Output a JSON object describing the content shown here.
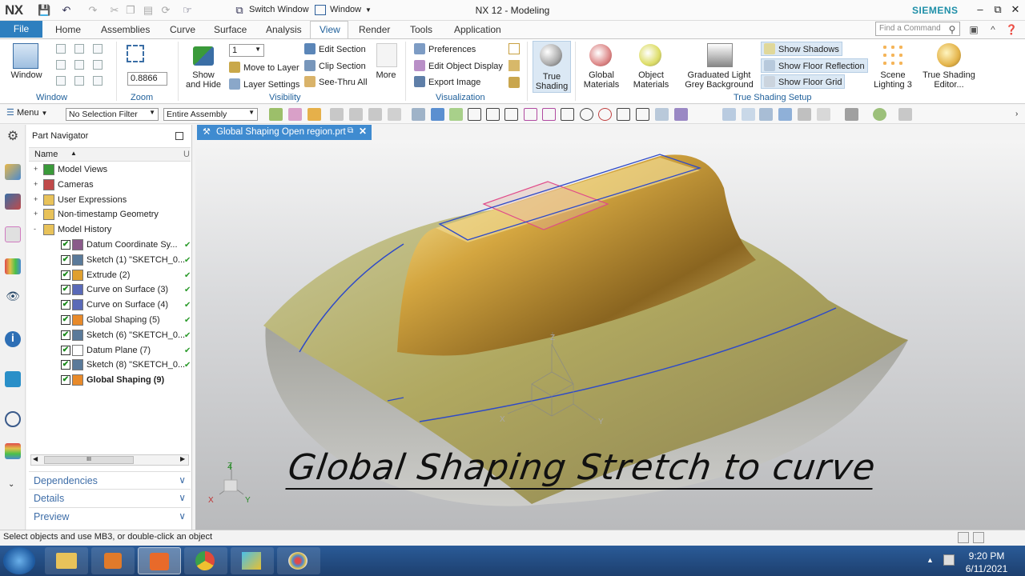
{
  "titlebar": {
    "logo": "NX",
    "switch_window": "Switch Window",
    "window_menu": "Window",
    "title": "NX 12 - Modeling",
    "brand": "SIEMENS",
    "icons": [
      "save-icon",
      "undo-icon",
      "redo-icon",
      "cut-icon",
      "copy-icon",
      "paste-icon",
      "repeat-icon",
      "touch-mode-icon",
      "switch-window-icon",
      "window-icon",
      "minimize-icon",
      "restore-icon",
      "close-icon"
    ]
  },
  "ribbon_tabs": {
    "file": "File",
    "tabs": [
      "Home",
      "Assemblies",
      "Curve",
      "Surface",
      "Analysis",
      "View",
      "Render",
      "Tools",
      "Application"
    ],
    "active": "View",
    "search_placeholder": "Find a Command"
  },
  "ribbon": {
    "window_group": {
      "button": "Window",
      "label": "Window"
    },
    "zoom_group": {
      "value": "0.8866",
      "label": "Zoom"
    },
    "visibility_group": {
      "layer_value": "1",
      "show_hide": "Show\nand Hide",
      "move_to_layer": "Move to Layer",
      "layer_settings": "Layer Settings",
      "edit_section": "Edit Section",
      "clip_section": "Clip Section",
      "see_thru_all": "See-Thru All",
      "more": "More",
      "label": "Visibility"
    },
    "visualization_group": {
      "preferences": "Preferences",
      "edit_object_display": "Edit Object Display",
      "export_image": "Export Image",
      "label": "Visualization"
    },
    "true_shading": "True\nShading",
    "true_shading_setup": {
      "global_materials": "Global\nMaterials",
      "object_materials": "Object\nMaterials",
      "graduated": "Graduated Light\nGrey Background",
      "show_shadows": "Show Shadows",
      "show_floor_reflection": "Show Floor Reflection",
      "show_floor_grid": "Show Floor Grid",
      "scene_lighting": "Scene\nLighting 3",
      "true_shading_editor": "True Shading\nEditor...",
      "label": "True Shading Setup"
    }
  },
  "selection_bar": {
    "menu": "Menu",
    "filter": "No Selection Filter",
    "scope": "Entire Assembly"
  },
  "part_navigator": {
    "title": "Part Navigator",
    "column": "Name",
    "col2": "U",
    "nodes": [
      {
        "label": "Model Views",
        "level": 0,
        "expand": "+",
        "checked": false,
        "icon": "model-views-icon",
        "tick": false,
        "bold": false
      },
      {
        "label": "Cameras",
        "level": 0,
        "expand": "+",
        "checked": false,
        "icon": "camera-icon",
        "tick": false,
        "bold": false
      },
      {
        "label": "User Expressions",
        "level": 0,
        "expand": "+",
        "checked": false,
        "icon": "folder-icon",
        "tick": false,
        "bold": false
      },
      {
        "label": "Non-timestamp Geometry",
        "level": 0,
        "expand": "+",
        "checked": false,
        "icon": "folder-icon",
        "tick": false,
        "bold": false
      },
      {
        "label": "Model History",
        "level": 0,
        "expand": "-",
        "checked": false,
        "icon": "folder-icon",
        "tick": false,
        "bold": false
      },
      {
        "label": "Datum Coordinate Sy...",
        "level": 1,
        "expand": "",
        "checked": true,
        "icon": "datum-csys-icon",
        "tick": true,
        "bold": false
      },
      {
        "label": "Sketch (1) \"SKETCH_0...",
        "level": 1,
        "expand": "",
        "checked": true,
        "icon": "sketch-icon",
        "tick": true,
        "bold": false
      },
      {
        "label": "Extrude (2)",
        "level": 1,
        "expand": "",
        "checked": true,
        "icon": "extrude-icon",
        "tick": true,
        "bold": false
      },
      {
        "label": "Curve on Surface (3)",
        "level": 1,
        "expand": "",
        "checked": true,
        "icon": "curve-on-surface-icon",
        "tick": true,
        "bold": false
      },
      {
        "label": "Curve on Surface (4)",
        "level": 1,
        "expand": "",
        "checked": true,
        "icon": "curve-on-surface-icon",
        "tick": true,
        "bold": false
      },
      {
        "label": "Global Shaping (5)",
        "level": 1,
        "expand": "",
        "checked": true,
        "icon": "global-shaping-icon",
        "tick": true,
        "bold": false
      },
      {
        "label": "Sketch (6) \"SKETCH_0...",
        "level": 1,
        "expand": "",
        "checked": true,
        "icon": "sketch-icon",
        "tick": true,
        "bold": false
      },
      {
        "label": "Datum Plane (7)",
        "level": 1,
        "expand": "",
        "checked": true,
        "icon": "datum-plane-icon",
        "tick": true,
        "bold": false
      },
      {
        "label": "Sketch (8) \"SKETCH_0...",
        "level": 1,
        "expand": "",
        "checked": true,
        "icon": "sketch-icon",
        "tick": true,
        "bold": false
      },
      {
        "label": "Global Shaping (9)",
        "level": 1,
        "expand": "",
        "checked": true,
        "icon": "global-shaping-icon",
        "tick": false,
        "bold": true
      }
    ],
    "scroll_label": "III",
    "panels": [
      "Dependencies",
      "Details",
      "Preview"
    ]
  },
  "graphics": {
    "tab_title": "Global Shaping Open region.prt",
    "overlay_title": "Global Shaping Stretch to curve",
    "triad_labels": {
      "x": "X",
      "y": "Y",
      "z": "Z"
    }
  },
  "status": {
    "text": "Select objects and use MB3, or double-click an object"
  },
  "taskbar": {
    "apps": [
      "start-orb-icon",
      "file-explorer-icon",
      "media-player-icon",
      "nx-app-icon",
      "chrome-icon",
      "nx-launcher-icon",
      "paint-icon"
    ],
    "time": "9:20 PM",
    "date": "6/11/2021"
  },
  "colors": {
    "accent": "#2e7fbf",
    "group_label": "#1e5f9a",
    "brand": "#1e8fa8",
    "taskbar": "#1d3f6e"
  }
}
